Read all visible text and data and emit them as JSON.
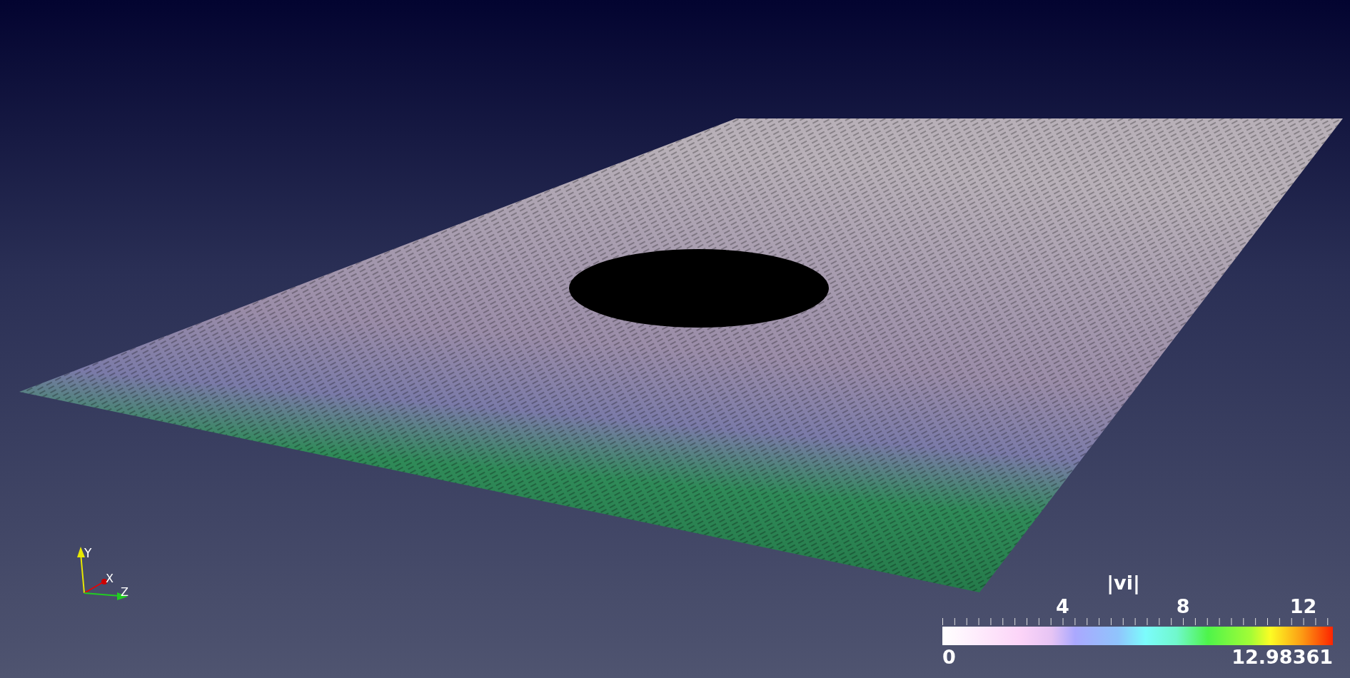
{
  "orientation_axes": {
    "labels": [
      "Y",
      "X",
      "Z"
    ]
  },
  "color_legend": {
    "title": "|vi|",
    "tick_labels": [
      "4",
      "8",
      "12"
    ],
    "min_label": "0",
    "max_label": "12.98361"
  }
}
